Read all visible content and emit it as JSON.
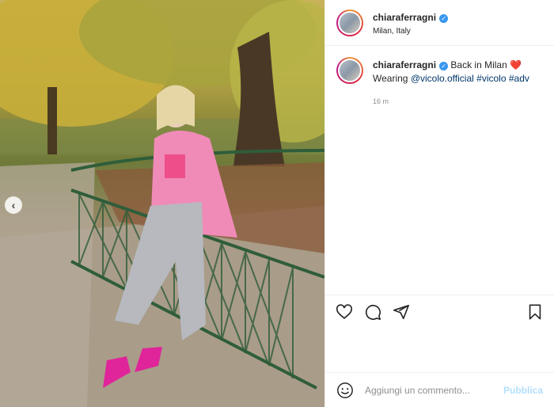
{
  "post": {
    "username": "chiaraferragni",
    "verified": true,
    "location": "Milan, Italy",
    "caption": {
      "text_main": "Back in Milan",
      "emoji": "❤️",
      "line2_prefix": "Wearing",
      "mention": "@vicolo.official",
      "hashtag1": "#vicolo",
      "hashtag2": "#adv"
    },
    "timestamp": "16 m"
  },
  "actions": {
    "like_icon": "heart-icon",
    "comment_icon": "comment-icon",
    "share_icon": "paper-plane-icon",
    "save_icon": "bookmark-icon"
  },
  "comment_box": {
    "placeholder": "Aggiungi un commento...",
    "publish_label": "Pubblica"
  },
  "colors": {
    "link": "#00376b",
    "verified": "#3897f0",
    "publish_disabled": "#b2dffc",
    "muted": "#8e8e8e"
  }
}
